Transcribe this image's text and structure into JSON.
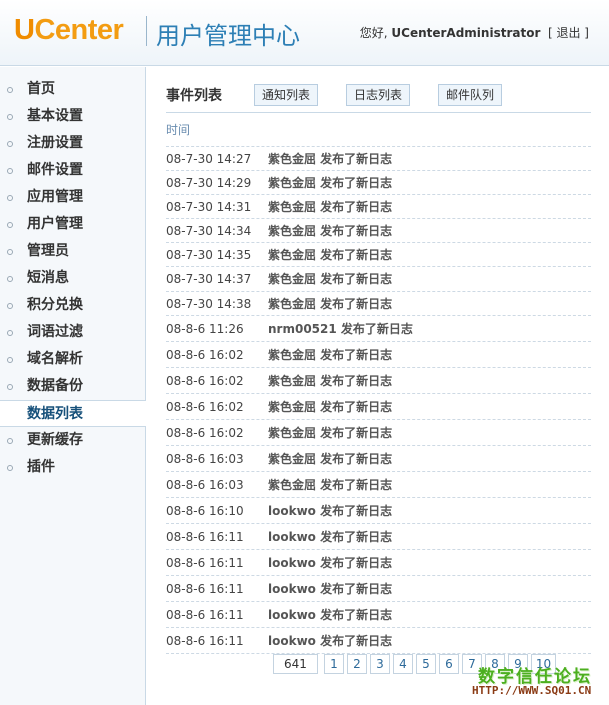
{
  "header": {
    "logo_u": "U",
    "logo_c": "Center",
    "title": "用户管理中心",
    "greeting": "您好,",
    "username": "UCenterAdministrator",
    "logout": "[ 退出 ]"
  },
  "sidebar": {
    "items": [
      {
        "label": "首页"
      },
      {
        "label": "基本设置"
      },
      {
        "label": "注册设置"
      },
      {
        "label": "邮件设置"
      },
      {
        "label": "应用管理"
      },
      {
        "label": "用户管理"
      },
      {
        "label": "管理员"
      },
      {
        "label": "短消息"
      },
      {
        "label": "积分兑换"
      },
      {
        "label": "词语过滤"
      },
      {
        "label": "域名解析"
      },
      {
        "label": "数据备份"
      },
      {
        "label": "数据列表"
      },
      {
        "label": "更新缓存"
      },
      {
        "label": "插件"
      }
    ],
    "active_index": 12
  },
  "main": {
    "tab_title": "事件列表",
    "tab_buttons": [
      "通知列表",
      "日志列表",
      "邮件队列"
    ],
    "column_header": "时间",
    "rows": [
      {
        "time": "08-7-30 14:27",
        "event": "紫色金屈  发布了新日志"
      },
      {
        "time": "08-7-30 14:29",
        "event": "紫色金屈  发布了新日志"
      },
      {
        "time": "08-7-30 14:31",
        "event": "紫色金屈  发布了新日志"
      },
      {
        "time": "08-7-30 14:34",
        "event": "紫色金屈  发布了新日志"
      },
      {
        "time": "08-7-30 14:35",
        "event": "紫色金屈  发布了新日志"
      },
      {
        "time": "08-7-30 14:37",
        "event": "紫色金屈  发布了新日志"
      },
      {
        "time": "08-7-30 14:38",
        "event": "紫色金屈  发布了新日志"
      },
      {
        "time": "08-8-6 11:26",
        "event": "nrm00521 发布了新日志"
      },
      {
        "time": "08-8-6 16:02",
        "event": "紫色金屈  发布了新日志"
      },
      {
        "time": "08-8-6 16:02",
        "event": "紫色金屈  发布了新日志"
      },
      {
        "time": "08-8-6 16:02",
        "event": "紫色金屈  发布了新日志"
      },
      {
        "time": "08-8-6 16:02",
        "event": "紫色金屈  发布了新日志"
      },
      {
        "time": "08-8-6 16:03",
        "event": "紫色金屈  发布了新日志"
      },
      {
        "time": "08-8-6 16:03",
        "event": "紫色金屈  发布了新日志"
      },
      {
        "time": "08-8-6 16:10",
        "event": "lookwo 发布了新日志"
      },
      {
        "time": "08-8-6 16:11",
        "event": "lookwo 发布了新日志"
      },
      {
        "time": "08-8-6 16:11",
        "event": "lookwo 发布了新日志"
      },
      {
        "time": "08-8-6 16:11",
        "event": "lookwo 发布了新日志"
      },
      {
        "time": "08-8-6 16:11",
        "event": "lookwo 发布了新日志"
      },
      {
        "time": "08-8-6 16:11",
        "event": "lookwo 发布了新日志"
      }
    ]
  },
  "pagination": {
    "total": "641",
    "pages": [
      "1",
      "2",
      "3",
      "4",
      "5",
      "6",
      "7",
      "8",
      "9",
      "10"
    ]
  },
  "watermark": {
    "text": "数字信任论坛",
    "url": "HTTP://WWW.SQ01.CN"
  }
}
